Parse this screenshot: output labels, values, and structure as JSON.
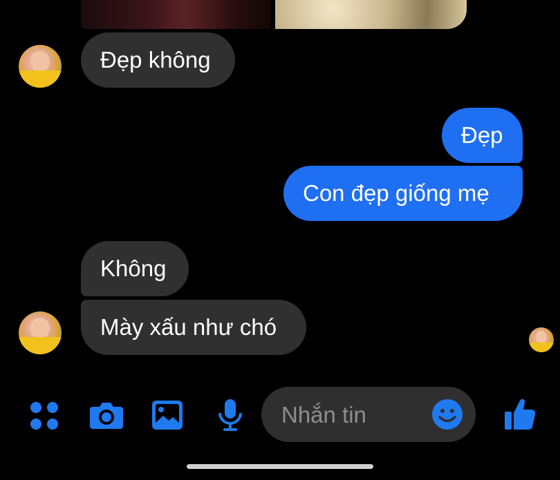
{
  "colors": {
    "background": "#000000",
    "incoming_bubble": "#303030",
    "outgoing_bubble": "#1f6ff2",
    "accent_icon": "#1f7aef",
    "placeholder": "#8e8e8e"
  },
  "messages": [
    {
      "side": "incoming",
      "text": "Đẹp không"
    },
    {
      "side": "outgoing",
      "text": "Đẹp"
    },
    {
      "side": "outgoing",
      "text": "Con đẹp giống mẹ"
    },
    {
      "side": "incoming",
      "text": "Không"
    },
    {
      "side": "incoming",
      "text": "Mày xấu như chó"
    }
  ],
  "composer": {
    "placeholder": "Nhắn tin"
  },
  "toolbar_icons": [
    "apps-grid-icon",
    "camera-icon",
    "gallery-icon",
    "microphone-icon",
    "emoji-icon",
    "thumbs-up-icon"
  ]
}
